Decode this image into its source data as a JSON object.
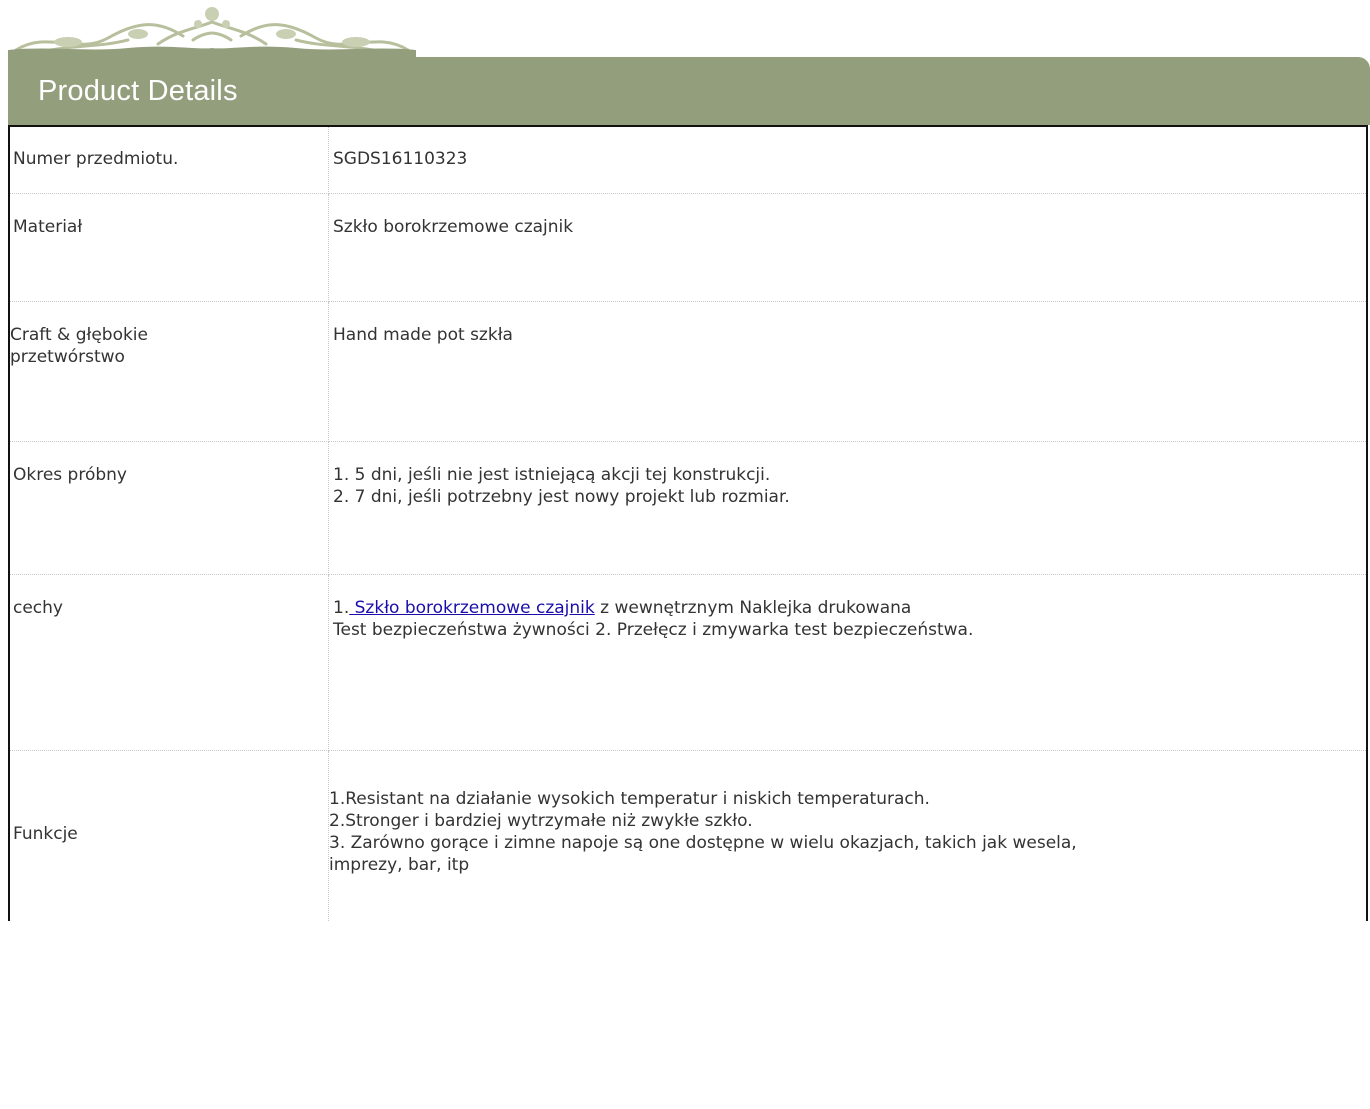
{
  "header": {
    "title": "Product Details"
  },
  "rows": [
    {
      "label": "Numer przedmiotu.",
      "value": "SGDS16110323"
    },
    {
      "label": "Materiał",
      "value": " Szkło borokrzemowe czajnik"
    },
    {
      "label": " Craft & głębokie\nprzetwórstwo",
      "value": "  Hand made pot szkła"
    },
    {
      "label": "Okres próbny",
      "value": " 1. 5 dni, jeśli nie jest istniejącą akcji tej konstrukcji.\n 2. 7 dni, jeśli potrzebny jest nowy projekt lub rozmiar."
    },
    {
      "label": "cechy",
      "value_prefix": " 1.",
      "value_link": " Szkło borokrzemowe czajnik",
      "value_suffix": " z wewnętrznym Naklejka drukowana\n Test bezpieczeństwa żywności 2. Przełęcz i zmywarka test bezpieczeństwa."
    },
    {
      "label": "Funkcje",
      "value": " 1.Resistant na działanie wysokich temperatur i niskich temperaturach.\n 2.Stronger i bardziej wytrzymałe niż zwykłe szkło.\n 3. Zarówno gorące i zimne napoje są one dostępne w wielu okazjach, takich jak wesela,\nimprezy, bar, itp"
    }
  ],
  "colors": {
    "header_bg": "#939e7d",
    "header_text": "#ffffff",
    "ornament": "#c9cfb3",
    "link": "#1a0dab"
  }
}
